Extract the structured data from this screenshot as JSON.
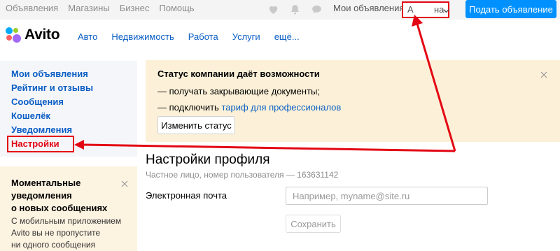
{
  "topbar": {
    "links": [
      "Объявления",
      "Магазины",
      "Бизнес",
      "Помощь"
    ],
    "icons": [
      "heart-icon",
      "bell-icon",
      "chat-icon"
    ],
    "my_ads": "Мои объявления",
    "user_first": "А",
    "user_last": "на",
    "post_button": "Подать объявление"
  },
  "header": {
    "logo_text": "Avito",
    "nav": [
      "Авто",
      "Недвижимость",
      "Работа",
      "Услуги",
      "ещё..."
    ]
  },
  "sidebar": {
    "items": [
      {
        "label": "Мои объявления"
      },
      {
        "label": "Рейтинг и отзывы"
      },
      {
        "label": "Сообщения"
      },
      {
        "label": "Кошелёк"
      },
      {
        "label": "Уведомления"
      },
      {
        "label": "Настройки",
        "active": true
      }
    ]
  },
  "notification": {
    "title_lines": [
      "Моментальные",
      "уведомления",
      "о новых сообщениях"
    ],
    "text_lines": [
      "С мобильным приложением",
      "Avito вы не пропустите",
      "ни одного сообщения"
    ]
  },
  "promo": {
    "title": "Статус компании даёт возможности",
    "line1": "— получать закрывающие документы;",
    "line2_prefix": "— подключить ",
    "line2_link": "тариф для профессионалов",
    "button": "Изменить статус"
  },
  "profile": {
    "title": "Настройки профиля",
    "subtitle": "Частное лицо, номер пользователя — 163631142",
    "email_label": "Электронная почта",
    "email_placeholder": "Например, myname@site.ru",
    "email_value": "",
    "save_button": "Сохранить"
  },
  "colors": {
    "accent_blue": "#0091ff",
    "link_blue": "#0a5ec4",
    "annotation_red": "#e30613",
    "sidebar_bg": "#f5f6fa",
    "promo_bg": "#fcf1d8"
  }
}
